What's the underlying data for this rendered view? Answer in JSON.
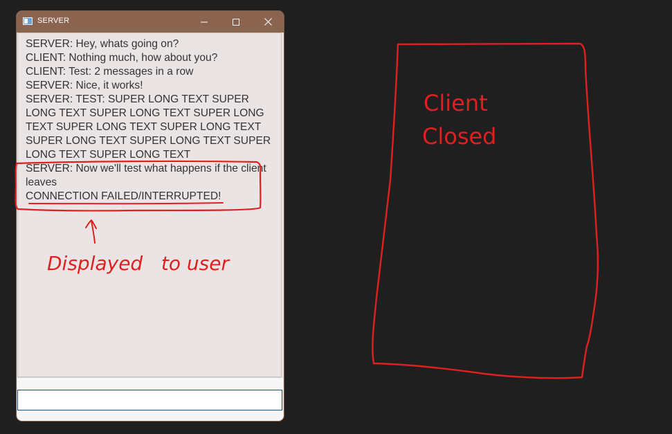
{
  "window": {
    "title": "SERVER",
    "icon": "app-window-icon",
    "controls": {
      "minimize_icon": "minimize-icon",
      "maximize_icon": "maximize-icon",
      "close_icon": "close-icon"
    }
  },
  "messages": [
    "SERVER: Hey, whats going on?",
    "CLIENT: Nothing much, how about you?",
    "CLIENT: Test: 2 messages in a row",
    "SERVER: Nice, it works!",
    "SERVER: TEST: SUPER LONG TEXT SUPER LONG TEXT SUPER LONG TEXT SUPER LONG TEXT SUPER LONG TEXT SUPER LONG TEXT SUPER LONG TEXT SUPER LONG TEXT SUPER LONG TEXT SUPER LONG TEXT",
    "SERVER: Now we'll test what happens if the client leaves",
    "CONNECTION FAILED/INTERRUPTED!"
  ],
  "input": {
    "value": "",
    "placeholder": ""
  },
  "annotations": {
    "displayed_note": "Displayed   to user",
    "client_closed_line1": "Client",
    "client_closed_line2": "Closed",
    "color": "#e02020"
  },
  "colors": {
    "titlebar": "#8b644f",
    "window_bg": "#eae5e4",
    "desktop_bg": "#1f1f1f",
    "text": "#333333",
    "input_border": "#1c4f77"
  }
}
